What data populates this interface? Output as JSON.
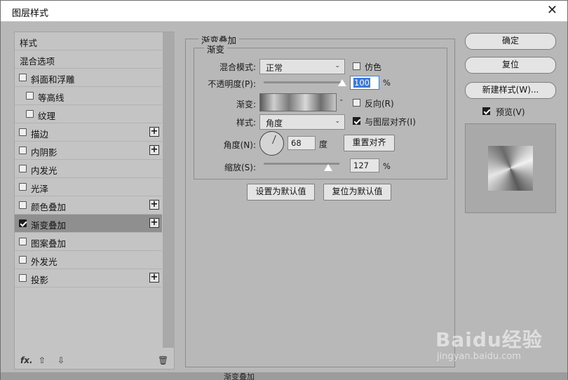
{
  "window": {
    "title": "图层样式",
    "close_glyph": "✕"
  },
  "styles": {
    "items": [
      {
        "label": "样式",
        "checkbox": false,
        "checked": false,
        "plus": false,
        "indent": 0,
        "selected": false
      },
      {
        "label": "混合选项",
        "checkbox": false,
        "checked": false,
        "plus": false,
        "indent": 0,
        "selected": false
      },
      {
        "label": "斜面和浮雕",
        "checkbox": true,
        "checked": false,
        "plus": false,
        "indent": 0,
        "selected": false
      },
      {
        "label": "等高线",
        "checkbox": true,
        "checked": false,
        "plus": false,
        "indent": 1,
        "selected": false
      },
      {
        "label": "纹理",
        "checkbox": true,
        "checked": false,
        "plus": false,
        "indent": 1,
        "selected": false
      },
      {
        "label": "描边",
        "checkbox": true,
        "checked": false,
        "plus": true,
        "indent": 0,
        "selected": false
      },
      {
        "label": "内阴影",
        "checkbox": true,
        "checked": false,
        "plus": true,
        "indent": 0,
        "selected": false
      },
      {
        "label": "内发光",
        "checkbox": true,
        "checked": false,
        "plus": false,
        "indent": 0,
        "selected": false
      },
      {
        "label": "光泽",
        "checkbox": true,
        "checked": false,
        "plus": false,
        "indent": 0,
        "selected": false
      },
      {
        "label": "颜色叠加",
        "checkbox": true,
        "checked": false,
        "plus": true,
        "indent": 0,
        "selected": false
      },
      {
        "label": "渐变叠加",
        "checkbox": true,
        "checked": true,
        "plus": true,
        "indent": 0,
        "selected": true
      },
      {
        "label": "图案叠加",
        "checkbox": true,
        "checked": false,
        "plus": false,
        "indent": 0,
        "selected": false
      },
      {
        "label": "外发光",
        "checkbox": true,
        "checked": false,
        "plus": false,
        "indent": 0,
        "selected": false
      },
      {
        "label": "投影",
        "checkbox": true,
        "checked": false,
        "plus": true,
        "indent": 0,
        "selected": false
      }
    ],
    "plus_glyph": "+",
    "bottom_icons": {
      "fx": "fx.",
      "up": "⇧",
      "down": "⇩",
      "trash": "🗑"
    }
  },
  "gradient_overlay": {
    "group_title": "渐变叠加",
    "subgroup_title": "渐变",
    "blend_mode_label": "混合模式:",
    "blend_mode_value": "正常",
    "dither_label": "仿色",
    "dither_checked": false,
    "opacity_label": "不透明度(P):",
    "opacity_value": "100",
    "opacity_unit": "%",
    "opacity_level": 1.0,
    "gradient_label": "渐变:",
    "reverse_label": "反向(R)",
    "reverse_checked": false,
    "style_label": "样式:",
    "style_value": "角度",
    "align_label": "与图层对齐(I)",
    "align_checked": true,
    "angle_label": "角度(N):",
    "angle_value": "68",
    "angle_unit": "度",
    "reset_align_button": "重置对齐",
    "scale_label": "缩放(S):",
    "scale_value": "127",
    "scale_unit": "%",
    "scale_level": 0.85,
    "set_default_button": "设置为默认值",
    "reset_default_button": "复位为默认值",
    "combo_arrow": "⌄"
  },
  "right_panel": {
    "ok_button": "确定",
    "reset_button": "复位",
    "new_style_button": "新建样式(W)...",
    "preview_label": "预览(V)",
    "preview_checked": true
  },
  "footer": {
    "text": "渐变叠加"
  },
  "watermark": {
    "brand": "Baidu经验",
    "url": "jingyan.baidu.com"
  }
}
